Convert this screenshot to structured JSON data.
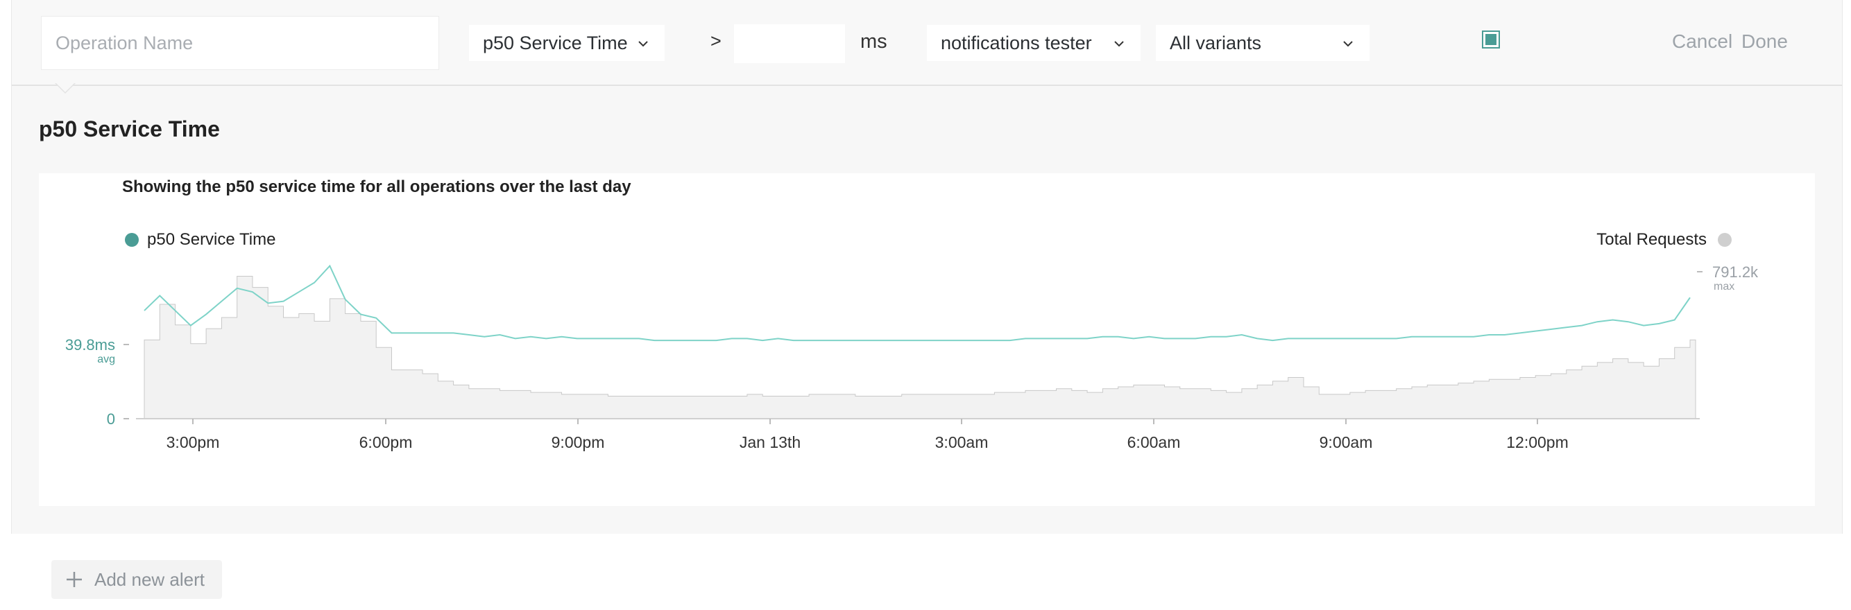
{
  "toolbar": {
    "operation_placeholder": "Operation Name",
    "metric_selected": "p50 Service Time",
    "comparator": ">",
    "threshold_value": "",
    "unit": "ms",
    "notification_selected": "notifications tester",
    "variants_selected": "All variants",
    "checkbox_checked": true,
    "cancel_label": "Cancel",
    "done_label": "Done"
  },
  "section": {
    "title": "p50 Service Time"
  },
  "chart": {
    "subtitle": "Showing the p50 service time for all operations over the last day",
    "legend_left": "p50 Service Time",
    "legend_right": "Total Requests",
    "avg_value": "39.8ms",
    "avg_label": "avg",
    "zero_label": "0",
    "max_value": "791.2k",
    "max_label": "max",
    "colors": {
      "latency": "#4a9c95",
      "latency_line": "#7ed3c8",
      "requests": "#f2f2f2",
      "requests_stroke": "#c8c8c8"
    }
  },
  "chart_data": {
    "type": "line",
    "x_ticks": [
      "3:00pm",
      "6:00pm",
      "9:00pm",
      "Jan 13th",
      "3:00am",
      "6:00am",
      "9:00am",
      "12:00pm"
    ],
    "ylim_latency_ms": [
      0,
      79.6
    ],
    "ylim_requests": [
      0,
      791200
    ],
    "series": [
      {
        "name": "p50 Service Time",
        "unit": "ms",
        "values": [
          58,
          66,
          58,
          50,
          56,
          63,
          70,
          68,
          62,
          63,
          68,
          73,
          82,
          64,
          56,
          54,
          46,
          46,
          46,
          46,
          46,
          45,
          44,
          45,
          43,
          44,
          43,
          44,
          43,
          43,
          43,
          43,
          43,
          42,
          42,
          42,
          42,
          42,
          43,
          43,
          42,
          43,
          42,
          42,
          42,
          42,
          42,
          42,
          42,
          42,
          42,
          42,
          42,
          42,
          42,
          42,
          42,
          43,
          43,
          43,
          43,
          43,
          44,
          44,
          43,
          44,
          43,
          43,
          43,
          44,
          44,
          45,
          43,
          42,
          43,
          43,
          43,
          43,
          43,
          43,
          43,
          43,
          44,
          44,
          44,
          44,
          44,
          45,
          45,
          46,
          47,
          48,
          49,
          50,
          52,
          53,
          52,
          50,
          51,
          53,
          65
        ]
      },
      {
        "name": "Total Requests",
        "values": [
          420000,
          610000,
          500000,
          400000,
          480000,
          540000,
          760000,
          700000,
          600000,
          540000,
          560000,
          520000,
          640000,
          560000,
          520000,
          380000,
          260000,
          260000,
          240000,
          200000,
          180000,
          160000,
          160000,
          150000,
          150000,
          140000,
          140000,
          130000,
          130000,
          130000,
          120000,
          120000,
          120000,
          120000,
          120000,
          120000,
          120000,
          120000,
          120000,
          130000,
          120000,
          120000,
          120000,
          130000,
          130000,
          130000,
          120000,
          120000,
          120000,
          130000,
          130000,
          130000,
          130000,
          130000,
          130000,
          140000,
          140000,
          150000,
          150000,
          160000,
          150000,
          140000,
          160000,
          170000,
          180000,
          180000,
          170000,
          160000,
          160000,
          150000,
          140000,
          160000,
          180000,
          200000,
          220000,
          170000,
          130000,
          130000,
          140000,
          150000,
          150000,
          160000,
          170000,
          180000,
          180000,
          190000,
          200000,
          210000,
          210000,
          220000,
          230000,
          240000,
          260000,
          280000,
          300000,
          320000,
          300000,
          280000,
          320000,
          380000,
          420000
        ]
      }
    ]
  },
  "add_alert": {
    "label": "Add new alert"
  }
}
